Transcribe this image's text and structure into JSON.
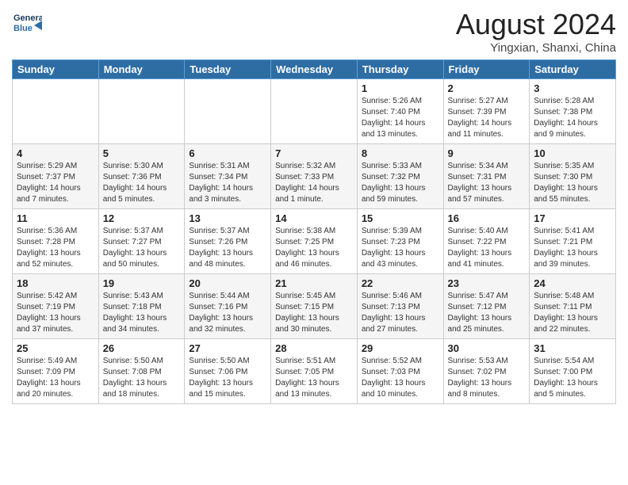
{
  "header": {
    "logo_general": "General",
    "logo_blue": "Blue",
    "month_title": "August 2024",
    "location": "Yingxian, Shanxi, China"
  },
  "days_of_week": [
    "Sunday",
    "Monday",
    "Tuesday",
    "Wednesday",
    "Thursday",
    "Friday",
    "Saturday"
  ],
  "weeks": [
    [
      null,
      null,
      null,
      null,
      {
        "day": "1",
        "sunrise": "Sunrise: 5:26 AM",
        "sunset": "Sunset: 7:40 PM",
        "daylight": "Daylight: 14 hours and 13 minutes."
      },
      {
        "day": "2",
        "sunrise": "Sunrise: 5:27 AM",
        "sunset": "Sunset: 7:39 PM",
        "daylight": "Daylight: 14 hours and 11 minutes."
      },
      {
        "day": "3",
        "sunrise": "Sunrise: 5:28 AM",
        "sunset": "Sunset: 7:38 PM",
        "daylight": "Daylight: 14 hours and 9 minutes."
      }
    ],
    [
      {
        "day": "4",
        "sunrise": "Sunrise: 5:29 AM",
        "sunset": "Sunset: 7:37 PM",
        "daylight": "Daylight: 14 hours and 7 minutes."
      },
      {
        "day": "5",
        "sunrise": "Sunrise: 5:30 AM",
        "sunset": "Sunset: 7:36 PM",
        "daylight": "Daylight: 14 hours and 5 minutes."
      },
      {
        "day": "6",
        "sunrise": "Sunrise: 5:31 AM",
        "sunset": "Sunset: 7:34 PM",
        "daylight": "Daylight: 14 hours and 3 minutes."
      },
      {
        "day": "7",
        "sunrise": "Sunrise: 5:32 AM",
        "sunset": "Sunset: 7:33 PM",
        "daylight": "Daylight: 14 hours and 1 minute."
      },
      {
        "day": "8",
        "sunrise": "Sunrise: 5:33 AM",
        "sunset": "Sunset: 7:32 PM",
        "daylight": "Daylight: 13 hours and 59 minutes."
      },
      {
        "day": "9",
        "sunrise": "Sunrise: 5:34 AM",
        "sunset": "Sunset: 7:31 PM",
        "daylight": "Daylight: 13 hours and 57 minutes."
      },
      {
        "day": "10",
        "sunrise": "Sunrise: 5:35 AM",
        "sunset": "Sunset: 7:30 PM",
        "daylight": "Daylight: 13 hours and 55 minutes."
      }
    ],
    [
      {
        "day": "11",
        "sunrise": "Sunrise: 5:36 AM",
        "sunset": "Sunset: 7:28 PM",
        "daylight": "Daylight: 13 hours and 52 minutes."
      },
      {
        "day": "12",
        "sunrise": "Sunrise: 5:37 AM",
        "sunset": "Sunset: 7:27 PM",
        "daylight": "Daylight: 13 hours and 50 minutes."
      },
      {
        "day": "13",
        "sunrise": "Sunrise: 5:37 AM",
        "sunset": "Sunset: 7:26 PM",
        "daylight": "Daylight: 13 hours and 48 minutes."
      },
      {
        "day": "14",
        "sunrise": "Sunrise: 5:38 AM",
        "sunset": "Sunset: 7:25 PM",
        "daylight": "Daylight: 13 hours and 46 minutes."
      },
      {
        "day": "15",
        "sunrise": "Sunrise: 5:39 AM",
        "sunset": "Sunset: 7:23 PM",
        "daylight": "Daylight: 13 hours and 43 minutes."
      },
      {
        "day": "16",
        "sunrise": "Sunrise: 5:40 AM",
        "sunset": "Sunset: 7:22 PM",
        "daylight": "Daylight: 13 hours and 41 minutes."
      },
      {
        "day": "17",
        "sunrise": "Sunrise: 5:41 AM",
        "sunset": "Sunset: 7:21 PM",
        "daylight": "Daylight: 13 hours and 39 minutes."
      }
    ],
    [
      {
        "day": "18",
        "sunrise": "Sunrise: 5:42 AM",
        "sunset": "Sunset: 7:19 PM",
        "daylight": "Daylight: 13 hours and 37 minutes."
      },
      {
        "day": "19",
        "sunrise": "Sunrise: 5:43 AM",
        "sunset": "Sunset: 7:18 PM",
        "daylight": "Daylight: 13 hours and 34 minutes."
      },
      {
        "day": "20",
        "sunrise": "Sunrise: 5:44 AM",
        "sunset": "Sunset: 7:16 PM",
        "daylight": "Daylight: 13 hours and 32 minutes."
      },
      {
        "day": "21",
        "sunrise": "Sunrise: 5:45 AM",
        "sunset": "Sunset: 7:15 PM",
        "daylight": "Daylight: 13 hours and 30 minutes."
      },
      {
        "day": "22",
        "sunrise": "Sunrise: 5:46 AM",
        "sunset": "Sunset: 7:13 PM",
        "daylight": "Daylight: 13 hours and 27 minutes."
      },
      {
        "day": "23",
        "sunrise": "Sunrise: 5:47 AM",
        "sunset": "Sunset: 7:12 PM",
        "daylight": "Daylight: 13 hours and 25 minutes."
      },
      {
        "day": "24",
        "sunrise": "Sunrise: 5:48 AM",
        "sunset": "Sunset: 7:11 PM",
        "daylight": "Daylight: 13 hours and 22 minutes."
      }
    ],
    [
      {
        "day": "25",
        "sunrise": "Sunrise: 5:49 AM",
        "sunset": "Sunset: 7:09 PM",
        "daylight": "Daylight: 13 hours and 20 minutes."
      },
      {
        "day": "26",
        "sunrise": "Sunrise: 5:50 AM",
        "sunset": "Sunset: 7:08 PM",
        "daylight": "Daylight: 13 hours and 18 minutes."
      },
      {
        "day": "27",
        "sunrise": "Sunrise: 5:50 AM",
        "sunset": "Sunset: 7:06 PM",
        "daylight": "Daylight: 13 hours and 15 minutes."
      },
      {
        "day": "28",
        "sunrise": "Sunrise: 5:51 AM",
        "sunset": "Sunset: 7:05 PM",
        "daylight": "Daylight: 13 hours and 13 minutes."
      },
      {
        "day": "29",
        "sunrise": "Sunrise: 5:52 AM",
        "sunset": "Sunset: 7:03 PM",
        "daylight": "Daylight: 13 hours and 10 minutes."
      },
      {
        "day": "30",
        "sunrise": "Sunrise: 5:53 AM",
        "sunset": "Sunset: 7:02 PM",
        "daylight": "Daylight: 13 hours and 8 minutes."
      },
      {
        "day": "31",
        "sunrise": "Sunrise: 5:54 AM",
        "sunset": "Sunset: 7:00 PM",
        "daylight": "Daylight: 13 hours and 5 minutes."
      }
    ]
  ]
}
